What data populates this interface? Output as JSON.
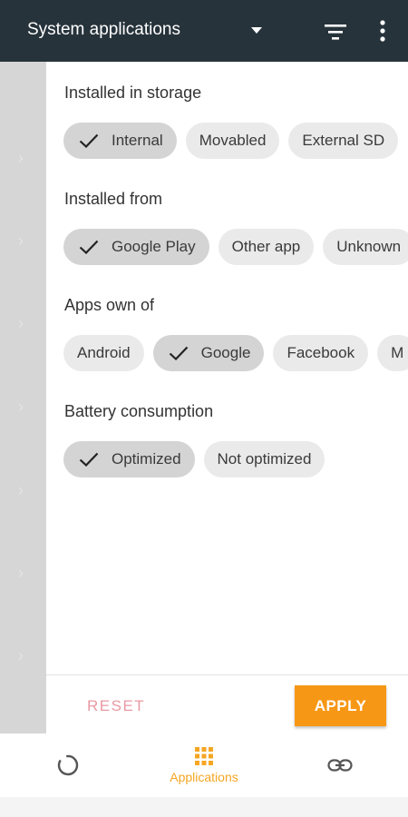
{
  "appbar": {
    "title": "System applications",
    "dropdown_icon": "caret-down-icon",
    "filter_icon": "filter-icon",
    "more_icon": "more-vert-icon",
    "background": "#27333b"
  },
  "filters": {
    "storage": {
      "title": "Installed in storage",
      "chips": [
        {
          "label": "Internal",
          "selected": true
        },
        {
          "label": "Movabled",
          "selected": false
        },
        {
          "label": "External SD",
          "selected": false
        }
      ]
    },
    "source": {
      "title": "Installed from",
      "chips": [
        {
          "label": "Google Play",
          "selected": true
        },
        {
          "label": "Other app",
          "selected": false
        },
        {
          "label": "Unknown",
          "selected": false
        }
      ]
    },
    "owner": {
      "title": "Apps own of",
      "chips": [
        {
          "label": "Android",
          "selected": false
        },
        {
          "label": "Google",
          "selected": true
        },
        {
          "label": "Facebook",
          "selected": false
        },
        {
          "label": "M",
          "selected": false
        }
      ]
    },
    "battery": {
      "title": "Battery consumption",
      "chips": [
        {
          "label": "Optimized",
          "selected": true
        },
        {
          "label": "Not optimized",
          "selected": false
        }
      ]
    }
  },
  "actions": {
    "reset_label": "RESET",
    "apply_label": "APPLY",
    "accent": "#f79716"
  },
  "bottom_nav": {
    "items": [
      {
        "icon": "loading-ring-icon",
        "label": ""
      },
      {
        "icon": "apps-grid-icon",
        "label": "Applications"
      },
      {
        "icon": "link-icon",
        "label": ""
      }
    ],
    "active_color": "#f5a623"
  }
}
